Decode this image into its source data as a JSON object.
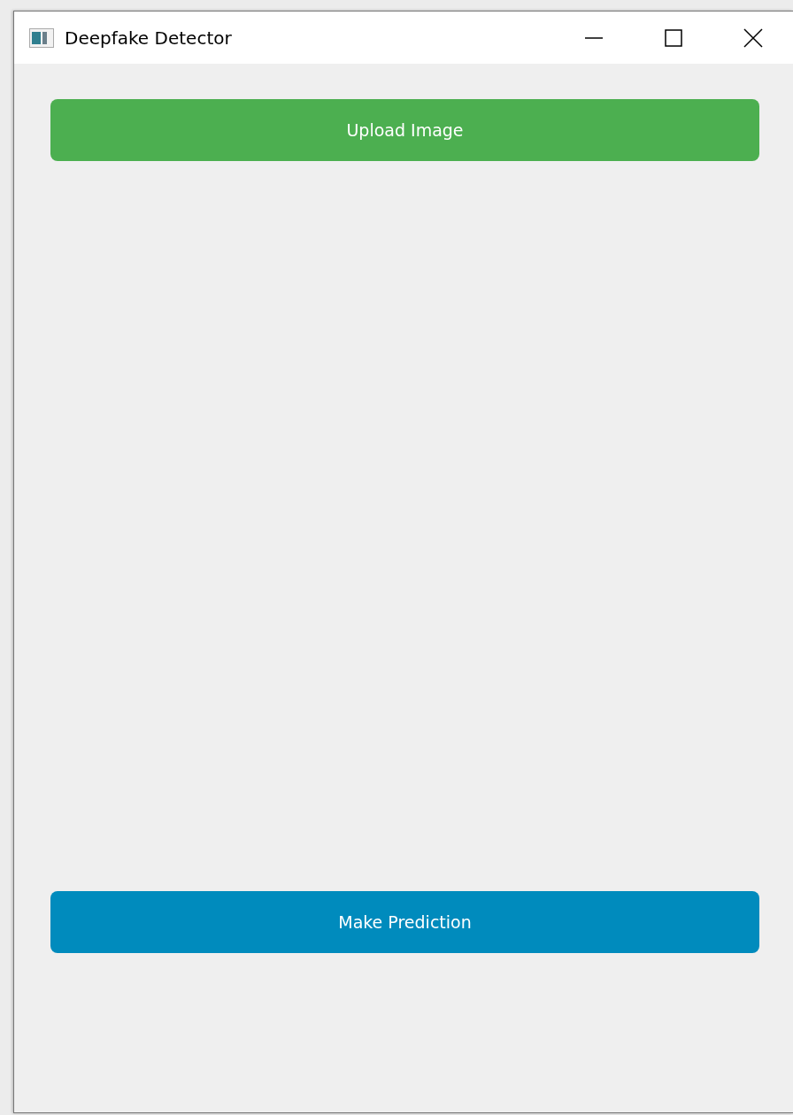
{
  "window": {
    "title": "Deepfake Detector"
  },
  "buttons": [
    {
      "label": "Upload Image",
      "kind": "upload"
    },
    {
      "label": "Make Prediction",
      "kind": "predict"
    }
  ]
}
